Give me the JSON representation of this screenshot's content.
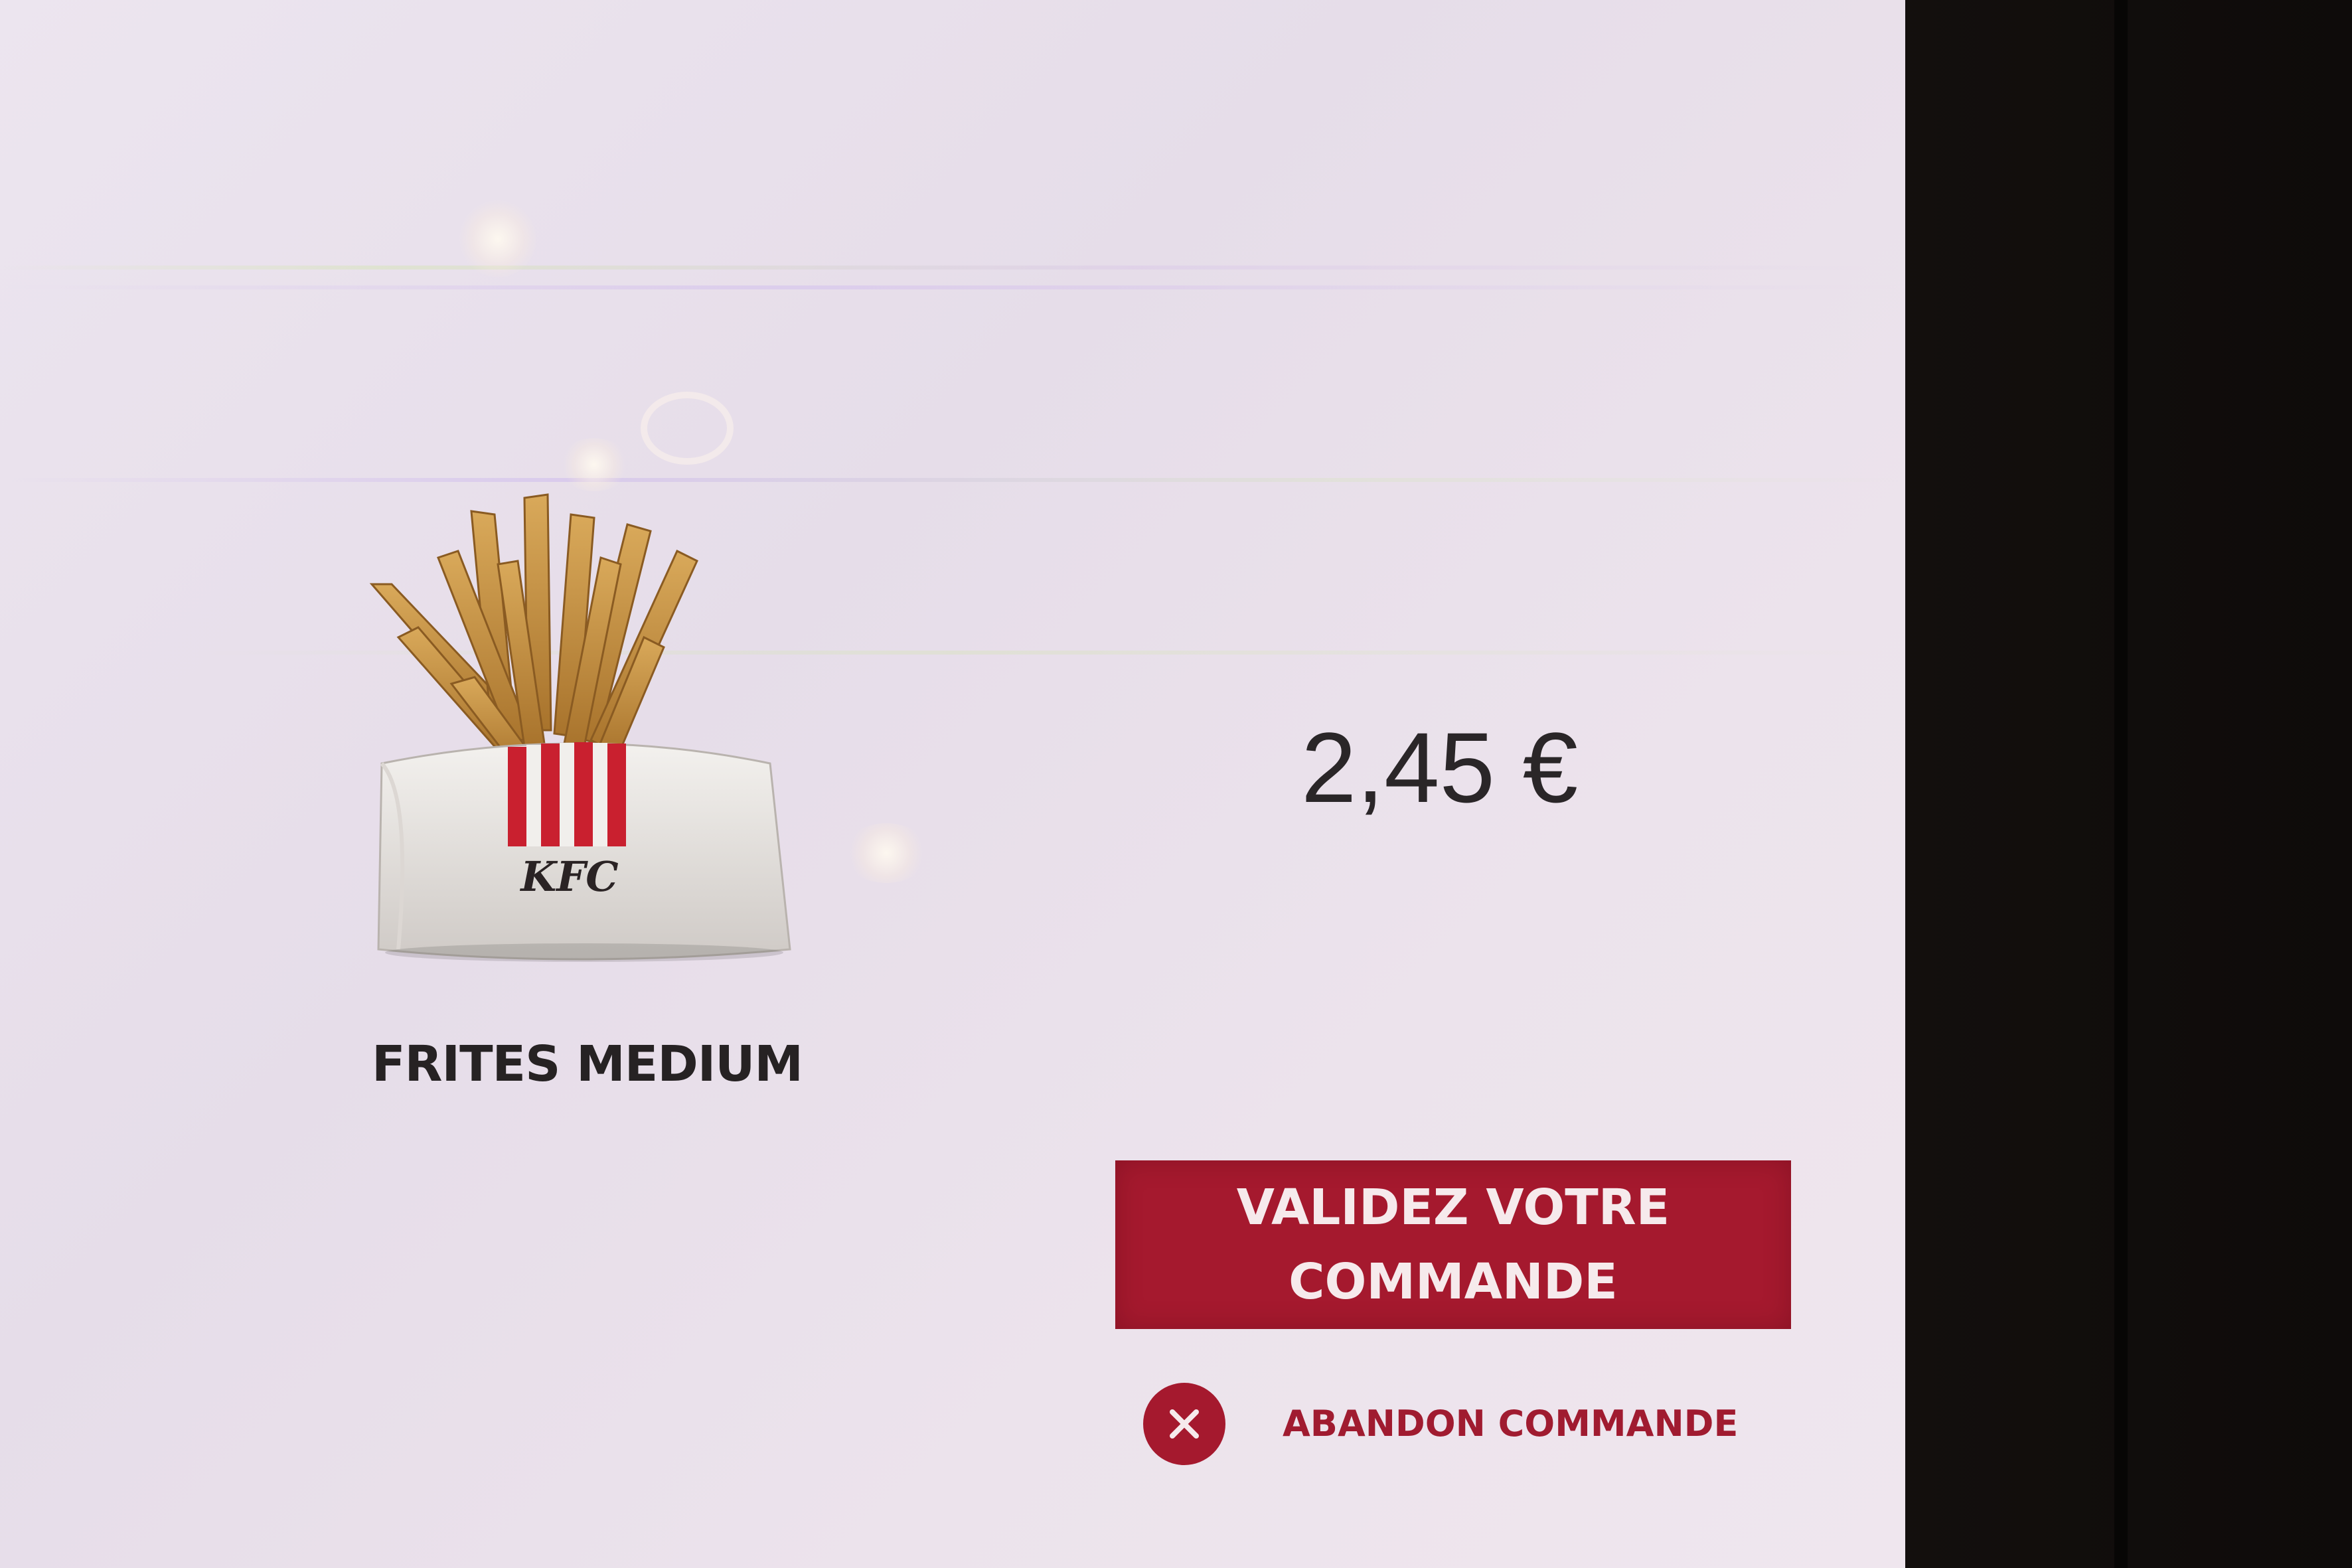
{
  "product": {
    "name": "FRITES MEDIUM",
    "price": "2,45 €",
    "image_icon": "fries-carton-image",
    "brand_mark": "KFC"
  },
  "actions": {
    "validate_label": "VALIDEZ VOTRE COMMANDE",
    "abandon_label": "ABANDON COMMANDE",
    "abandon_icon": "close-icon"
  },
  "colors": {
    "accent": "#a5192e",
    "text": "#262223",
    "screen_background": "#ebe3ec"
  }
}
